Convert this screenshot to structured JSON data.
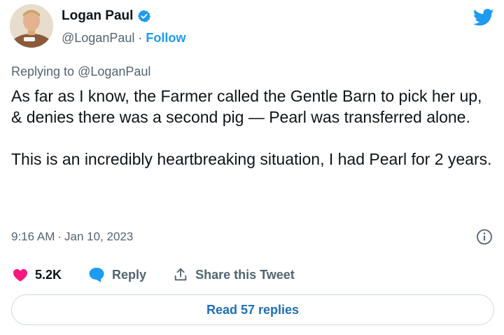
{
  "author": {
    "display_name": "Logan Paul",
    "handle": "@LoganPaul",
    "separator": "·",
    "follow_label": "Follow",
    "verified": true
  },
  "reply_context": {
    "prefix": "Replying to",
    "mention": "@LoganPaul"
  },
  "tweet": {
    "paragraphs": [
      "As far as I know, the Farmer called the Gentle Barn to pick her up, & denies there was a second pig — Pearl was transferred alone.",
      "This is an incredibly heartbreaking situation, I had Pearl for 2 years."
    ]
  },
  "meta": {
    "time": "9:16 AM",
    "separator": "·",
    "date": "Jan 10, 2023"
  },
  "actions": {
    "like_count": "5.2K",
    "reply_label": "Reply",
    "share_label": "Share this Tweet"
  },
  "read_replies_label": "Read 57 replies",
  "colors": {
    "accent": "#1d9bf0",
    "like": "#f91880",
    "text": "#0f1419",
    "muted": "#536471"
  },
  "icons": [
    "verified-badge-icon",
    "twitter-bird-icon",
    "info-icon",
    "heart-icon",
    "reply-bubble-icon",
    "share-icon"
  ]
}
